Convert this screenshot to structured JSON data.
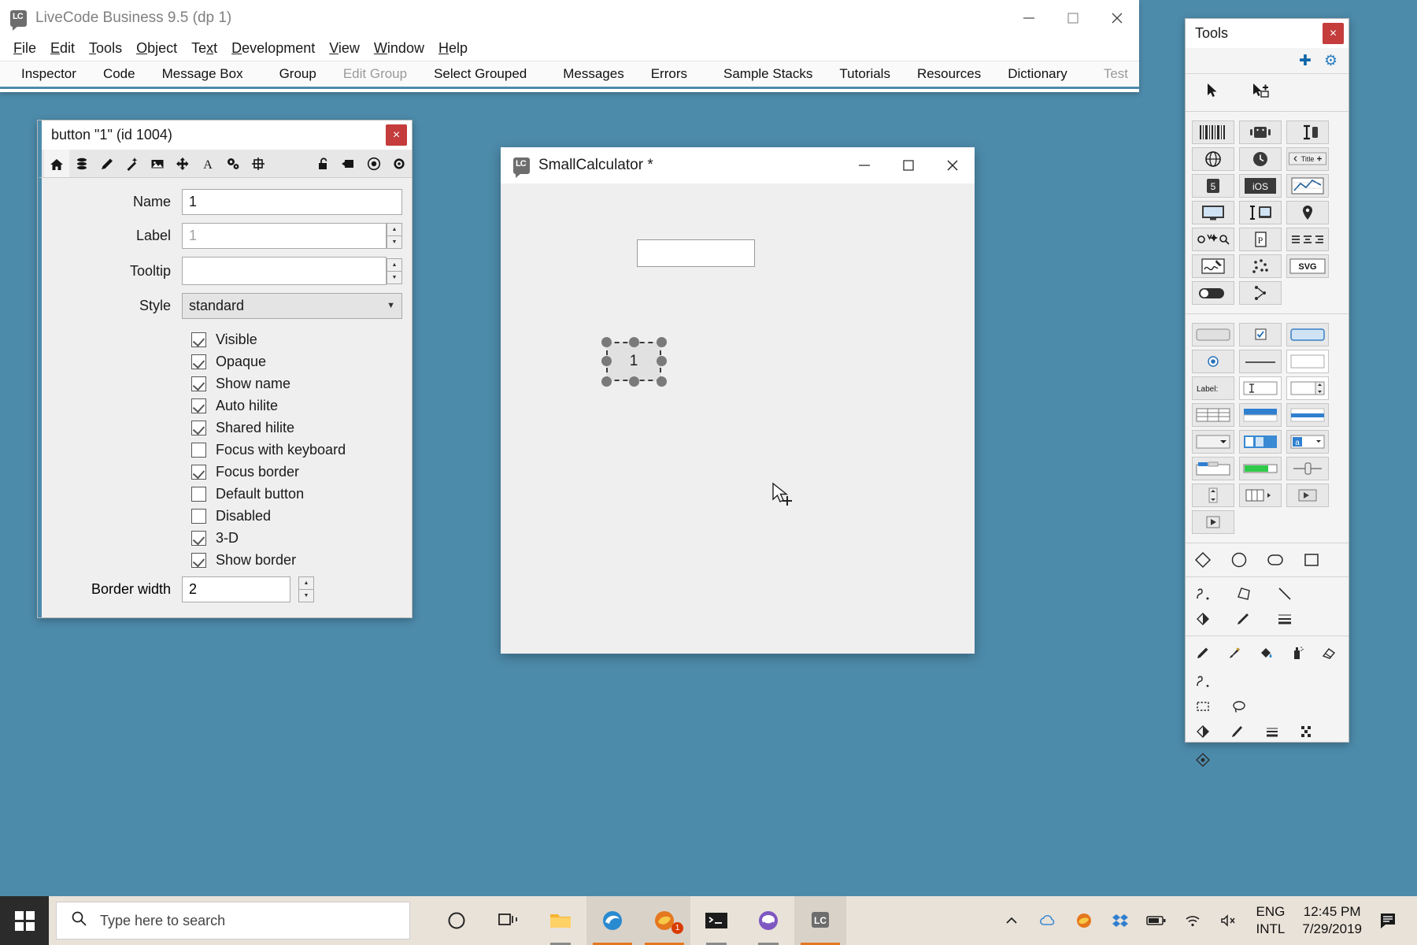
{
  "app": {
    "title": "LiveCode Business 9.5 (dp 1)",
    "logo_text": "LC"
  },
  "menubar": [
    {
      "label": "File"
    },
    {
      "label": "Edit"
    },
    {
      "label": "Tools"
    },
    {
      "label": "Object"
    },
    {
      "label": "Text"
    },
    {
      "label": "Development"
    },
    {
      "label": "View"
    },
    {
      "label": "Window"
    },
    {
      "label": "Help"
    }
  ],
  "toolbar": [
    {
      "label": "Inspector",
      "enabled": true
    },
    {
      "label": "Code",
      "enabled": true
    },
    {
      "label": "Message Box",
      "enabled": true
    },
    {
      "label": "Group",
      "enabled": true
    },
    {
      "label": "Edit Group",
      "enabled": false
    },
    {
      "label": "Select Grouped",
      "enabled": true
    },
    {
      "label": "Messages",
      "enabled": true
    },
    {
      "label": "Errors",
      "enabled": true
    },
    {
      "label": "Sample Stacks",
      "enabled": true
    },
    {
      "label": "Tutorials",
      "enabled": true
    },
    {
      "label": "Resources",
      "enabled": true
    },
    {
      "label": "Dictionary",
      "enabled": true
    },
    {
      "label": "Test",
      "enabled": false
    }
  ],
  "window_controls": {
    "minimize": "minimize-icon",
    "maximize": "maximize-icon",
    "close": "close-icon"
  },
  "inspector": {
    "title": "button \"1\" (id 1004)",
    "close_label": "×",
    "tabs": [
      {
        "name": "home-icon",
        "active": true
      },
      {
        "name": "database-icon",
        "active": false
      },
      {
        "name": "pencil-icon",
        "active": false
      },
      {
        "name": "magic-wand-icon",
        "active": false
      },
      {
        "name": "image-icon",
        "active": false
      },
      {
        "name": "move-icon",
        "active": false
      },
      {
        "name": "text-icon",
        "active": false
      },
      {
        "name": "gears-icon",
        "active": false
      },
      {
        "name": "align-icon",
        "active": false
      }
    ],
    "tabs_right": [
      {
        "name": "unlock-icon"
      },
      {
        "name": "apply-icon"
      },
      {
        "name": "target-icon"
      },
      {
        "name": "settings-gear-icon"
      }
    ],
    "fields": {
      "name_label": "Name",
      "name_value": "1",
      "label_label": "Label",
      "label_value": "1",
      "tooltip_label": "Tooltip",
      "tooltip_value": "",
      "style_label": "Style",
      "style_value": "standard"
    },
    "checkboxes": [
      {
        "label": "Visible",
        "checked": true
      },
      {
        "label": "Opaque",
        "checked": true
      },
      {
        "label": "Show name",
        "checked": true
      },
      {
        "label": "Auto hilite",
        "checked": true
      },
      {
        "label": "Shared hilite",
        "checked": true
      },
      {
        "label": "Focus with keyboard",
        "checked": false
      },
      {
        "label": "Focus border",
        "checked": true
      },
      {
        "label": "Default button",
        "checked": false
      },
      {
        "label": "Disabled",
        "checked": false
      },
      {
        "label": "3-D",
        "checked": true
      },
      {
        "label": "Show border",
        "checked": true
      }
    ],
    "border_width_label": "Border width",
    "border_width_value": "2"
  },
  "calculator": {
    "title": "SmallCalculator *",
    "logo_text": "LC",
    "field_value": "",
    "button_label": "1"
  },
  "tools": {
    "title": "Tools",
    "close_label": "×",
    "add_icon": "plus-icon",
    "settings_icon": "gear-icon",
    "pointer_tools": [
      {
        "name": "arrow-pointer-icon"
      },
      {
        "name": "edit-pointer-icon"
      }
    ],
    "widget_row1": [
      {
        "name": "barcode-widget-icon"
      },
      {
        "name": "android-widget-icon"
      },
      {
        "name": "text-cursor-widget-icon"
      },
      {
        "name": "device-widget-icon"
      }
    ],
    "widget_row2": [
      {
        "name": "browser-widget-icon"
      },
      {
        "name": "clock-widget-icon"
      },
      {
        "name": "title-bar-widget-icon",
        "label": "Title"
      }
    ],
    "widget_row3": [
      {
        "name": "html5-widget-icon",
        "label": "5"
      },
      {
        "name": "ios-widget-icon",
        "label": "iOS"
      },
      {
        "name": "chart-widget-icon"
      }
    ],
    "widget_row4": [
      {
        "name": "screen-widget-icon"
      },
      {
        "name": "tablet-widget-icon"
      },
      {
        "name": "map-pin-widget-icon"
      }
    ],
    "widget_row5": [
      {
        "name": "search-widget-icon"
      },
      {
        "name": "pdf-widget-icon",
        "label": "P"
      },
      {
        "name": "list-widget-icon"
      }
    ],
    "widget_row6": [
      {
        "name": "signature-widget-icon"
      },
      {
        "name": "scatter-widget-icon"
      },
      {
        "name": "svg-widget-icon",
        "label": "SVG"
      }
    ],
    "widget_row7": [
      {
        "name": "switch-widget-icon"
      },
      {
        "name": "tree-widget-icon"
      }
    ],
    "control_row1": [
      {
        "name": "push-button-tool-icon"
      },
      {
        "name": "checkbox-tool-icon"
      },
      {
        "name": "default-button-tool-icon"
      }
    ],
    "control_row2": [
      {
        "name": "radio-button-tool-icon"
      },
      {
        "name": "separator-tool-icon"
      },
      {
        "name": "rectangle-field-tool-icon"
      }
    ],
    "control_row3": [
      {
        "name": "label-field-tool-icon",
        "label": "Label:"
      },
      {
        "name": "text-entry-tool-icon"
      },
      {
        "name": "combo-box-tool-icon"
      }
    ],
    "control_row4": [
      {
        "name": "table-tool-icon"
      },
      {
        "name": "header-bar-tool-icon"
      },
      {
        "name": "nav-bar-tool-icon"
      }
    ],
    "control_row5": [
      {
        "name": "option-menu-tool-icon"
      },
      {
        "name": "button-bar-tool-icon"
      },
      {
        "name": "combo-tool-icon",
        "label": "a"
      }
    ],
    "control_row6": [
      {
        "name": "tab-panel-tool-icon"
      },
      {
        "name": "progress-bar-tool-icon"
      },
      {
        "name": "slider-tool-icon"
      }
    ],
    "control_row7": [
      {
        "name": "scrollbar-tool-icon"
      },
      {
        "name": "data-grid-tool-icon"
      },
      {
        "name": "player-tool-icon"
      }
    ],
    "control_row8": [
      {
        "name": "video-player-tool-icon"
      }
    ],
    "shape_tools": [
      {
        "name": "diamond-shape-icon"
      },
      {
        "name": "oval-shape-icon"
      },
      {
        "name": "rounded-rect-shape-icon"
      },
      {
        "name": "rectangle-shape-icon"
      }
    ],
    "draw_tools_row1": [
      {
        "name": "curve-tool-icon"
      },
      {
        "name": "polygon-tool-icon"
      },
      {
        "name": "line-tool-icon"
      }
    ],
    "draw_tools_row2": [
      {
        "name": "fill-color-icon"
      },
      {
        "name": "line-color-icon"
      },
      {
        "name": "line-width-icon"
      }
    ],
    "paint_tools_row1": [
      {
        "name": "pencil-paint-icon"
      },
      {
        "name": "brush-paint-icon"
      },
      {
        "name": "bucket-paint-icon"
      },
      {
        "name": "spray-paint-icon"
      },
      {
        "name": "eraser-paint-icon"
      },
      {
        "name": "curve-paint-icon"
      }
    ],
    "paint_tools_row2": [
      {
        "name": "select-region-icon"
      },
      {
        "name": "lasso-icon"
      }
    ],
    "paint_tools_row3": [
      {
        "name": "paint-fill-color-icon"
      },
      {
        "name": "paint-line-color-icon"
      },
      {
        "name": "paint-line-width-icon"
      },
      {
        "name": "paint-pattern-icon"
      },
      {
        "name": "paint-brush-shape-icon"
      }
    ]
  },
  "taskbar": {
    "search_placeholder": "Type here to search",
    "buttons": [
      {
        "name": "cortana-button"
      },
      {
        "name": "task-view-button"
      },
      {
        "name": "file-explorer-button"
      },
      {
        "name": "edge-button"
      },
      {
        "name": "firefox-button",
        "badge": "1"
      },
      {
        "name": "terminal-button"
      },
      {
        "name": "emacs-button"
      },
      {
        "name": "livecode-button"
      }
    ],
    "tray": {
      "chevron": "chevron-up-icon",
      "onedrive": "cloud-icon",
      "firefox": "firefox-tray-icon",
      "dropbox": "dropbox-icon",
      "battery": "battery-icon",
      "wifi": "wifi-icon",
      "volume": "volume-muted-icon",
      "lang_line1": "ENG",
      "lang_line2": "INTL",
      "time": "12:45 PM",
      "date": "7/29/2019",
      "action_center": "action-center-icon"
    }
  },
  "colors": {
    "desktop": "#4d8bab",
    "accent": "#4d8bab",
    "close_red": "#c43c3c",
    "taskbar": "#e9e2d8"
  }
}
